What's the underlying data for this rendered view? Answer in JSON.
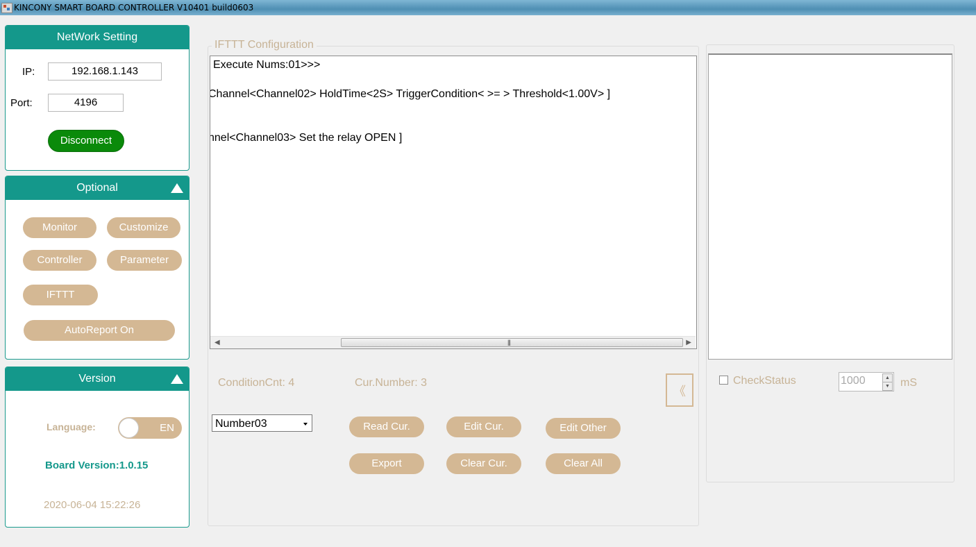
{
  "window": {
    "title": "KINCONY SMART BOARD CONTROLLER V10401 build0603"
  },
  "network": {
    "header": "NetWork Setting",
    "ip_label": "IP:",
    "ip_value": "192.168.1.143",
    "port_label": "Port:",
    "port_value": "4196",
    "disconnect_label": "Disconnect"
  },
  "optional": {
    "header": "Optional",
    "monitor": "Monitor",
    "customize": "Customize",
    "controller": "Controller",
    "parameter": "Parameter",
    "ifttt": "IFTTT",
    "autoreport": "AutoReport On"
  },
  "version": {
    "header": "Version",
    "language_label": "Language:",
    "language_value": "EN",
    "board_version": "Board Version:1.0.15",
    "datetime": "2020-06-04 15:22:26"
  },
  "ifttt": {
    "group_title": "IFTTT Configuration",
    "lines": [
      " Execute Nums:01>>>",
      "Channel<Channel02>   HoldTime<2S>    TriggerCondition< >= >  Threshold<1.00V>  ]",
      "nnel<Channel03> Set the relay OPEN ]"
    ],
    "condition_cnt": "ConditionCnt: 4",
    "cur_number": "Cur.Number: 3",
    "select_value": "Number03",
    "collapse_glyph": "《",
    "buttons": {
      "read_cur": "Read Cur.",
      "edit_cur": "Edit Cur.",
      "edit_other": "Edit Other",
      "export": "Export",
      "clear_cur": "Clear Cur.",
      "clear_all": "Clear All"
    }
  },
  "status": {
    "check_label": "CheckStatus",
    "interval_value": "1000",
    "unit": "mS"
  },
  "colors": {
    "teal": "#14988b",
    "tan": "#d4b894",
    "green": "#0a8a0a"
  }
}
